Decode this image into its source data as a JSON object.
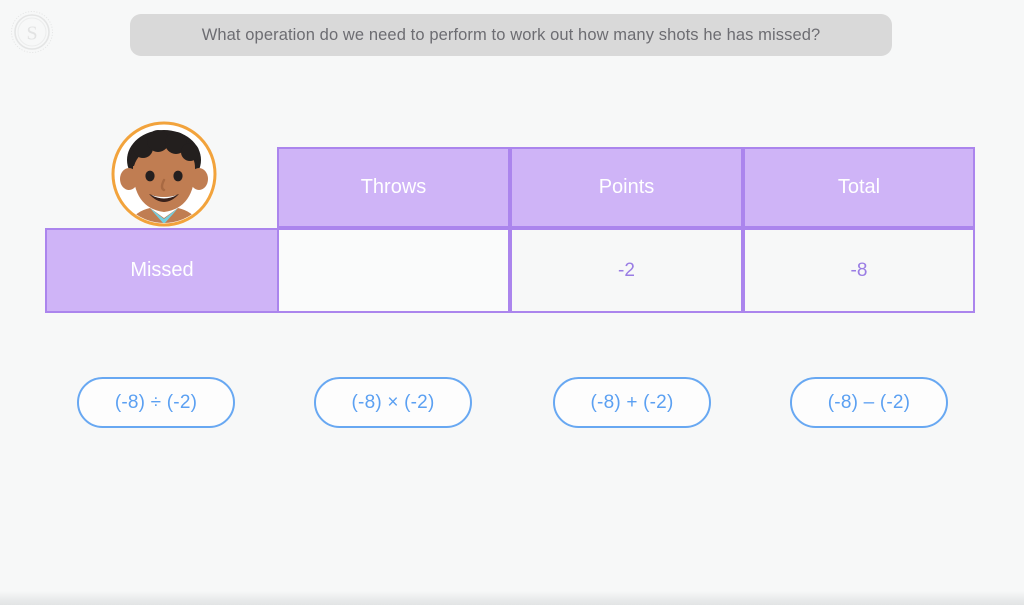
{
  "app": {
    "logo_icon": "circular-s-emblem-logo",
    "background_color": "#f7f8f8"
  },
  "question": {
    "text": "What operation do we need to perform to work out how many shots he has missed?",
    "banner_color": "#d9d9d9",
    "text_color": "#6d6d72"
  },
  "avatar": {
    "icon": "boy-face-avatar",
    "ring_color": "#f2a33c",
    "skin_color": "#c07d52",
    "hair_color": "#231f1e",
    "collar_color": "#74cfe0"
  },
  "table": {
    "header_fill": "#cfb4f7",
    "border_color": "#ab85ed",
    "value_color": "#9a7de4",
    "columns": [
      "",
      "Throws",
      "Points",
      "Total"
    ],
    "rows": [
      {
        "label": "Missed",
        "throws": "",
        "points": "-2",
        "total": "-8"
      }
    ]
  },
  "answers": {
    "accent_color": "#5ba0f2",
    "options": [
      {
        "label": "(-8) ÷ (-2)"
      },
      {
        "label": "(-8) × (-2)"
      },
      {
        "label": "(-8) + (-2)"
      },
      {
        "label": "(-8) – (-2)"
      }
    ]
  }
}
